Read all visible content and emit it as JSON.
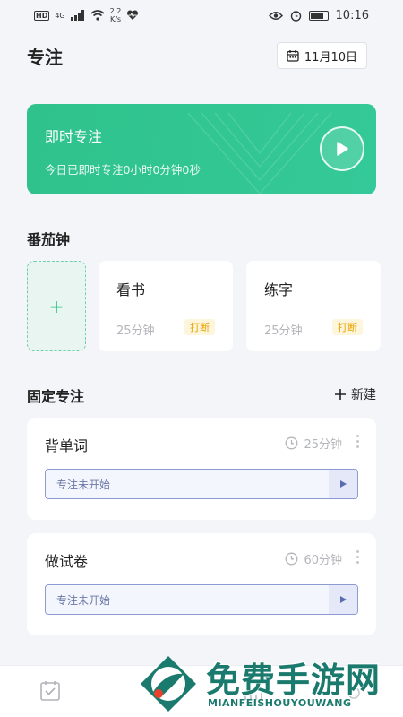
{
  "status_bar": {
    "hd": "HD",
    "network": "4G",
    "speed_value": "2.2",
    "speed_unit": "K/s",
    "time": "10:16"
  },
  "header": {
    "title": "专注",
    "date": "11月10日"
  },
  "instant": {
    "title": "即时专注",
    "summary": "今日已即时专注0小时0分钟0秒"
  },
  "tomato": {
    "title": "番茄钟",
    "add_label": "+",
    "items": [
      {
        "name": "看书",
        "duration": "25分钟",
        "tag": "打断"
      },
      {
        "name": "练字",
        "duration": "25分钟",
        "tag": "打断"
      }
    ]
  },
  "fixed": {
    "title": "固定专注",
    "new_label": "新建",
    "items": [
      {
        "name": "背单词",
        "duration": "25分钟",
        "status": "专注未开始"
      },
      {
        "name": "做试卷",
        "duration": "60分钟",
        "status": "专注未开始"
      }
    ]
  },
  "watermark": {
    "text": "免费手游网",
    "sub": "MIANFEISHOUYOUWANG"
  },
  "colors": {
    "accent_green": "#2fc28c",
    "tag_orange": "#e8a400",
    "progress_blue": "#8d9bd0",
    "background": "#f4f5f9"
  },
  "icons": {
    "date": "calendar-icon",
    "play": "play-icon",
    "clock": "clock-icon",
    "more": "more-vertical-icon",
    "go": "triangle-right-icon",
    "nav_tasks": "checklist-icon"
  }
}
